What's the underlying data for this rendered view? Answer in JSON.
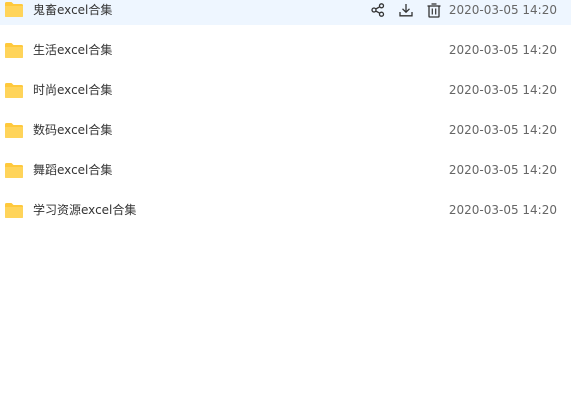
{
  "files": [
    {
      "name": "鬼畜excel合集",
      "time": "2020-03-05 14:20"
    },
    {
      "name": "生活excel合集",
      "time": "2020-03-05 14:20"
    },
    {
      "name": "时尚excel合集",
      "time": "2020-03-05 14:20"
    },
    {
      "name": "数码excel合集",
      "time": "2020-03-05 14:20"
    },
    {
      "name": "舞蹈excel合集",
      "time": "2020-03-05 14:20"
    },
    {
      "name": "学习资源excel合集",
      "time": "2020-03-05 14:20"
    }
  ],
  "actions": {
    "share_icon": "share-icon",
    "download_icon": "download-icon",
    "delete_icon": "trash-icon"
  },
  "colors": {
    "folder": "#ffc93c",
    "hover_background": "#eef6ff",
    "icon_stroke": "#333333"
  }
}
